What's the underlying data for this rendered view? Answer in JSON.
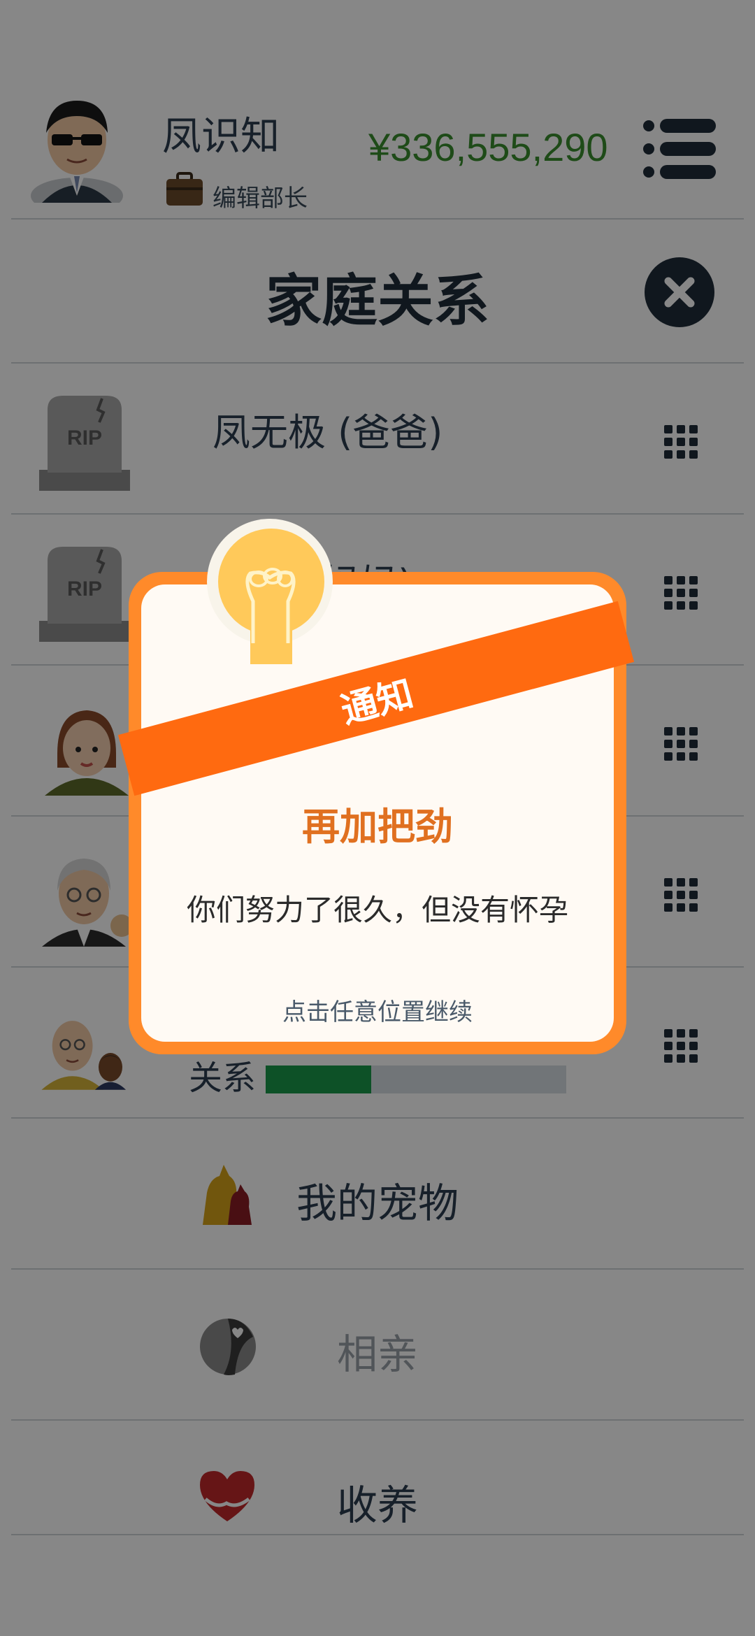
{
  "header": {
    "user_name": "凤识知",
    "job_title": "编辑部长",
    "money": "¥336,555,290"
  },
  "page": {
    "title": "家庭关系"
  },
  "family": [
    {
      "name": "凤无极 (爸爸)",
      "deceased": true
    },
    {
      "name": "(妈妈)",
      "deceased": true
    },
    {
      "name": "",
      "deceased": false
    },
    {
      "name": "",
      "deceased": false
    },
    {
      "name": "",
      "relation_label": "关系",
      "relation_level": 0.35,
      "deceased": false
    }
  ],
  "menu": {
    "pets": "我的宠物",
    "dating": "相亲",
    "adopt": "收养"
  },
  "dialog": {
    "ribbon": "通知",
    "heading": "再加把劲",
    "message": "你们努力了很久，但没有怀孕",
    "hint": "点击任意位置继续"
  },
  "colors": {
    "money": "#3a8f2e",
    "ribbon": "#ff6a10",
    "dialog_border": "#ff8a2a",
    "heading": "#e07020",
    "relation_bar": "#1a9a4a",
    "dark": "#1f2d3a"
  }
}
